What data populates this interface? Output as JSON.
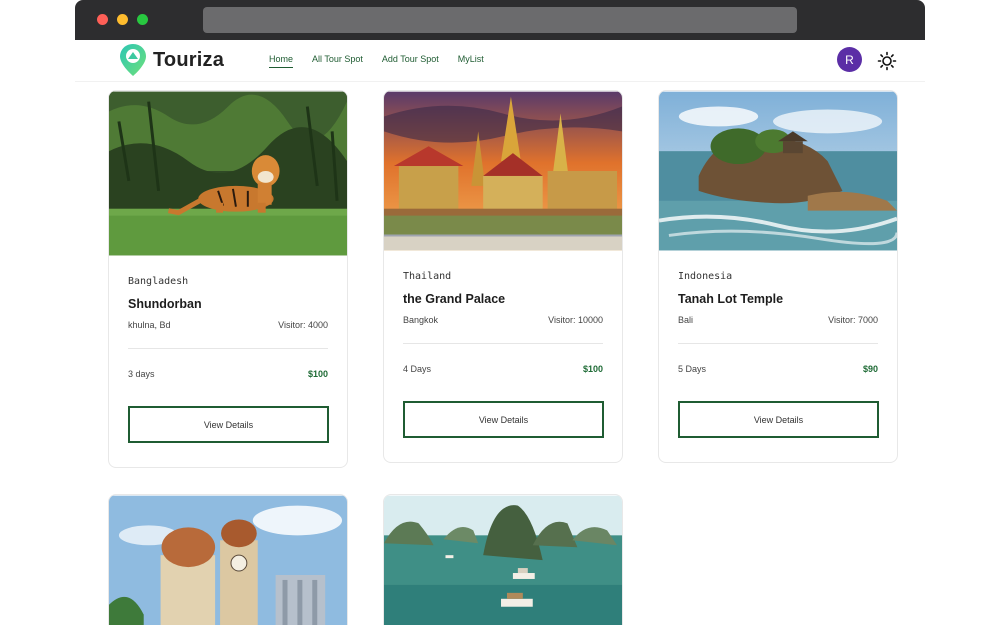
{
  "app": {
    "brand": "Touriza"
  },
  "nav": {
    "links": [
      "Home",
      "All Tour Spot",
      "Add Tour Spot",
      "MyList"
    ],
    "avatar_initial": "R"
  },
  "colors": {
    "primary": "#1f5c32",
    "avatar": "#5b2ea6",
    "price": "#1f6b36"
  },
  "cards": [
    {
      "country": "Bangladesh",
      "name": "Shundorban",
      "location": "khulna, Bd",
      "visitors": "Visitor: 4000",
      "duration": "3 days",
      "cost": "$100",
      "button": "View Details",
      "image": "tiger in jungle"
    },
    {
      "country": "Thailand",
      "name": "the Grand Palace",
      "location": "Bangkok",
      "visitors": "Visitor: 10000",
      "duration": "4 Days",
      "cost": "$100",
      "button": "View Details",
      "image": "grand palace temple"
    },
    {
      "country": "Indonesia",
      "name": "Tanah Lot Temple",
      "location": "Bali",
      "visitors": "Visitor: 7000",
      "duration": "5 Days",
      "cost": "$90",
      "button": "View Details",
      "image": "sea temple rock"
    },
    {
      "image": "domed colonial building"
    },
    {
      "image": "limestone bay with boats"
    }
  ]
}
